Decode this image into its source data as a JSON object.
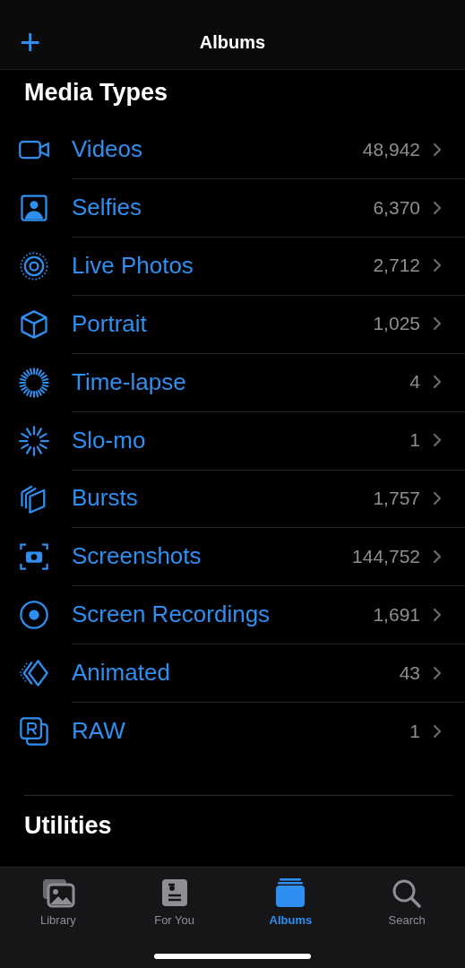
{
  "header": {
    "add_symbol": "+",
    "title": "Albums"
  },
  "media_types": {
    "title": "Media Types",
    "items": [
      {
        "kind": "video",
        "label": "Videos",
        "count": "48,942"
      },
      {
        "kind": "selfie",
        "label": "Selfies",
        "count": "6,370"
      },
      {
        "kind": "live",
        "label": "Live Photos",
        "count": "2,712"
      },
      {
        "kind": "portrait",
        "label": "Portrait",
        "count": "1,025"
      },
      {
        "kind": "timelapse",
        "label": "Time-lapse",
        "count": "4"
      },
      {
        "kind": "slomo",
        "label": "Slo-mo",
        "count": "1"
      },
      {
        "kind": "bursts",
        "label": "Bursts",
        "count": "1,757"
      },
      {
        "kind": "screenshot",
        "label": "Screenshots",
        "count": "144,752"
      },
      {
        "kind": "recording",
        "label": "Screen Recordings",
        "count": "1,691"
      },
      {
        "kind": "animated",
        "label": "Animated",
        "count": "43"
      },
      {
        "kind": "raw",
        "label": "RAW",
        "count": "1"
      }
    ]
  },
  "utilities": {
    "title": "Utilities"
  },
  "tab_bar": [
    {
      "kind": "library",
      "label": "Library",
      "selected": false
    },
    {
      "kind": "foryou",
      "label": "For You",
      "selected": false
    },
    {
      "kind": "albums",
      "label": "Albums",
      "selected": true
    },
    {
      "kind": "search",
      "label": "Search",
      "selected": false
    }
  ]
}
